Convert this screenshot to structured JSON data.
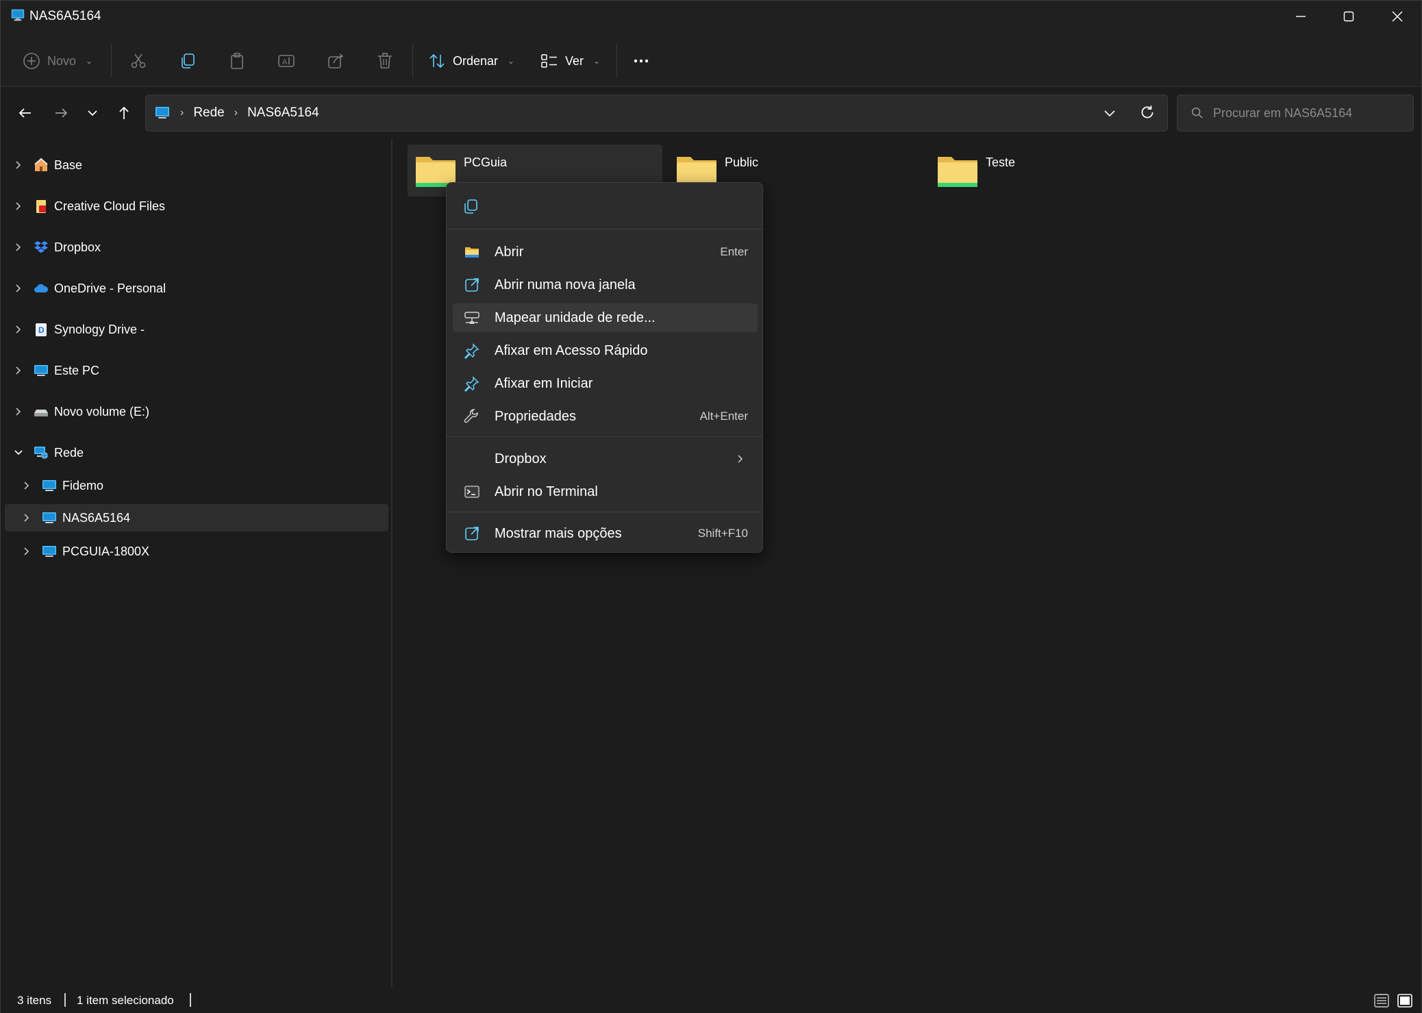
{
  "window": {
    "title": "NAS6A5164"
  },
  "toolbar": {
    "new_label": "Novo",
    "sort_label": "Ordenar",
    "view_label": "Ver"
  },
  "address": {
    "crumbs": [
      "Rede",
      "NAS6A5164"
    ]
  },
  "search": {
    "placeholder": "Procurar em NAS6A5164"
  },
  "sidebar": {
    "items": [
      {
        "label": "Base",
        "icon": "home-icon"
      },
      {
        "label": "Creative Cloud Files",
        "icon": "creative-cloud-folder-icon"
      },
      {
        "label": "Dropbox",
        "icon": "dropbox-icon"
      },
      {
        "label": "OneDrive - Personal",
        "icon": "onedrive-cloud-icon"
      },
      {
        "label": "Synology Drive -",
        "icon": "synology-drive-icon"
      },
      {
        "label": "Este PC",
        "icon": "computer-icon"
      },
      {
        "label": "Novo volume (E:)",
        "icon": "drive-icon"
      },
      {
        "label": "Rede",
        "icon": "network-icon"
      },
      {
        "label": "Fidemo",
        "icon": "computer-icon"
      },
      {
        "label": "NAS6A5164",
        "icon": "computer-icon"
      },
      {
        "label": "PCGUIA-1800X",
        "icon": "computer-icon"
      }
    ]
  },
  "files": [
    {
      "name": "PCGuia"
    },
    {
      "name": "Public"
    },
    {
      "name": "Teste"
    }
  ],
  "context_menu": {
    "items": [
      {
        "label": "Abrir",
        "shortcut": "Enter"
      },
      {
        "label": "Abrir numa nova janela",
        "shortcut": ""
      },
      {
        "label": "Mapear unidade de rede...",
        "shortcut": ""
      },
      {
        "label": "Afixar em Acesso Rápido",
        "shortcut": ""
      },
      {
        "label": "Afixar em Iniciar",
        "shortcut": ""
      },
      {
        "label": "Propriedades",
        "shortcut": "Alt+Enter"
      },
      {
        "label": "Dropbox",
        "shortcut": ""
      },
      {
        "label": "Abrir no Terminal",
        "shortcut": ""
      },
      {
        "label": "Mostrar mais opções",
        "shortcut": "Shift+F10"
      }
    ]
  },
  "status": {
    "count": "3 itens",
    "selection": "1 item selecionado"
  },
  "colors": {
    "background": "#1c1c1c",
    "toolbar": "#202020",
    "menu": "#2c2c2c",
    "accent": "#60cdff",
    "folder": "#f8d775"
  }
}
